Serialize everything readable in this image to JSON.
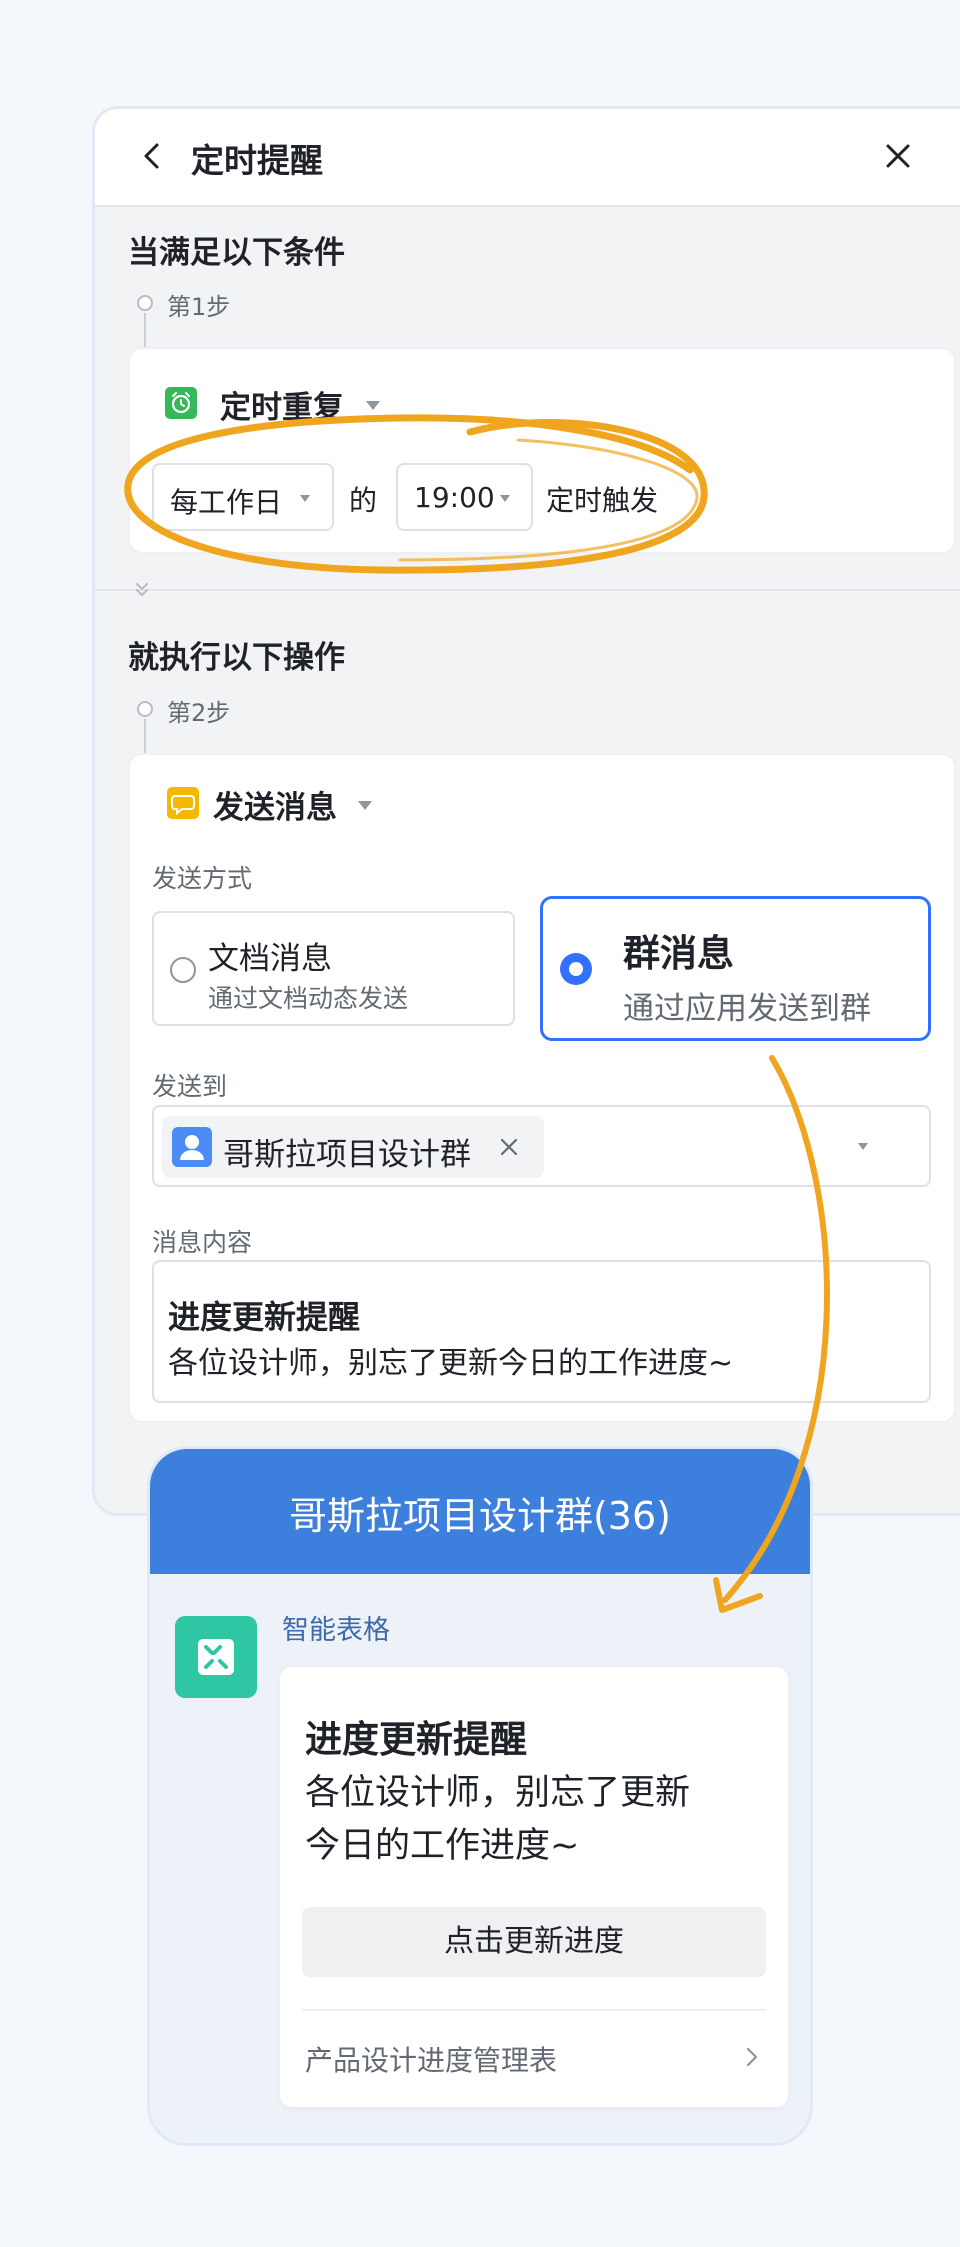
{
  "header": {
    "title": "定时提醒"
  },
  "trigger": {
    "section_title": "当满足以下条件",
    "step_label": "第1步",
    "card_title": "定时重复",
    "frequency_value": "每工作日",
    "connector": "的",
    "time_value": "19:00",
    "suffix": "定时触发"
  },
  "action": {
    "section_title": "就执行以下操作",
    "step_label": "第2步",
    "card_title": "发送消息",
    "method_label": "发送方式",
    "methods": [
      {
        "title": "文档消息",
        "subtitle": "通过文档动态发送",
        "selected": false
      },
      {
        "title": "群消息",
        "subtitle": "通过应用发送到群",
        "selected": true
      }
    ],
    "send_to_label": "发送到",
    "send_to_chip": "哥斯拉项目设计群",
    "content_label": "消息内容",
    "content_title": "进度更新提醒",
    "content_body": "各位设计师，别忘了更新今日的工作进度~"
  },
  "preview": {
    "group_title": "哥斯拉项目设计群(36)",
    "bot_name": "智能表格",
    "msg_title": "进度更新提醒",
    "msg_line1": "各位设计师，别忘了更新",
    "msg_line2": "今日的工作进度~",
    "button_label": "点击更新进度",
    "footer_link": "产品设计进度管理表"
  },
  "colors": {
    "accent": "#3370ff",
    "highlight_annotation": "#f0a51f",
    "group_header": "#3d7fdc",
    "alarm_icon": "#34b85a",
    "message_icon": "#f5b800",
    "app_icon": "#2fc7a3"
  },
  "icons": [
    "back-icon",
    "close-icon",
    "alarm-clock-icon",
    "chat-bubble-icon",
    "user-avatar-icon",
    "remove-icon",
    "dropdown-caret-icon",
    "grid-app-icon",
    "chevron-right-icon",
    "double-chevron-down-icon"
  ]
}
